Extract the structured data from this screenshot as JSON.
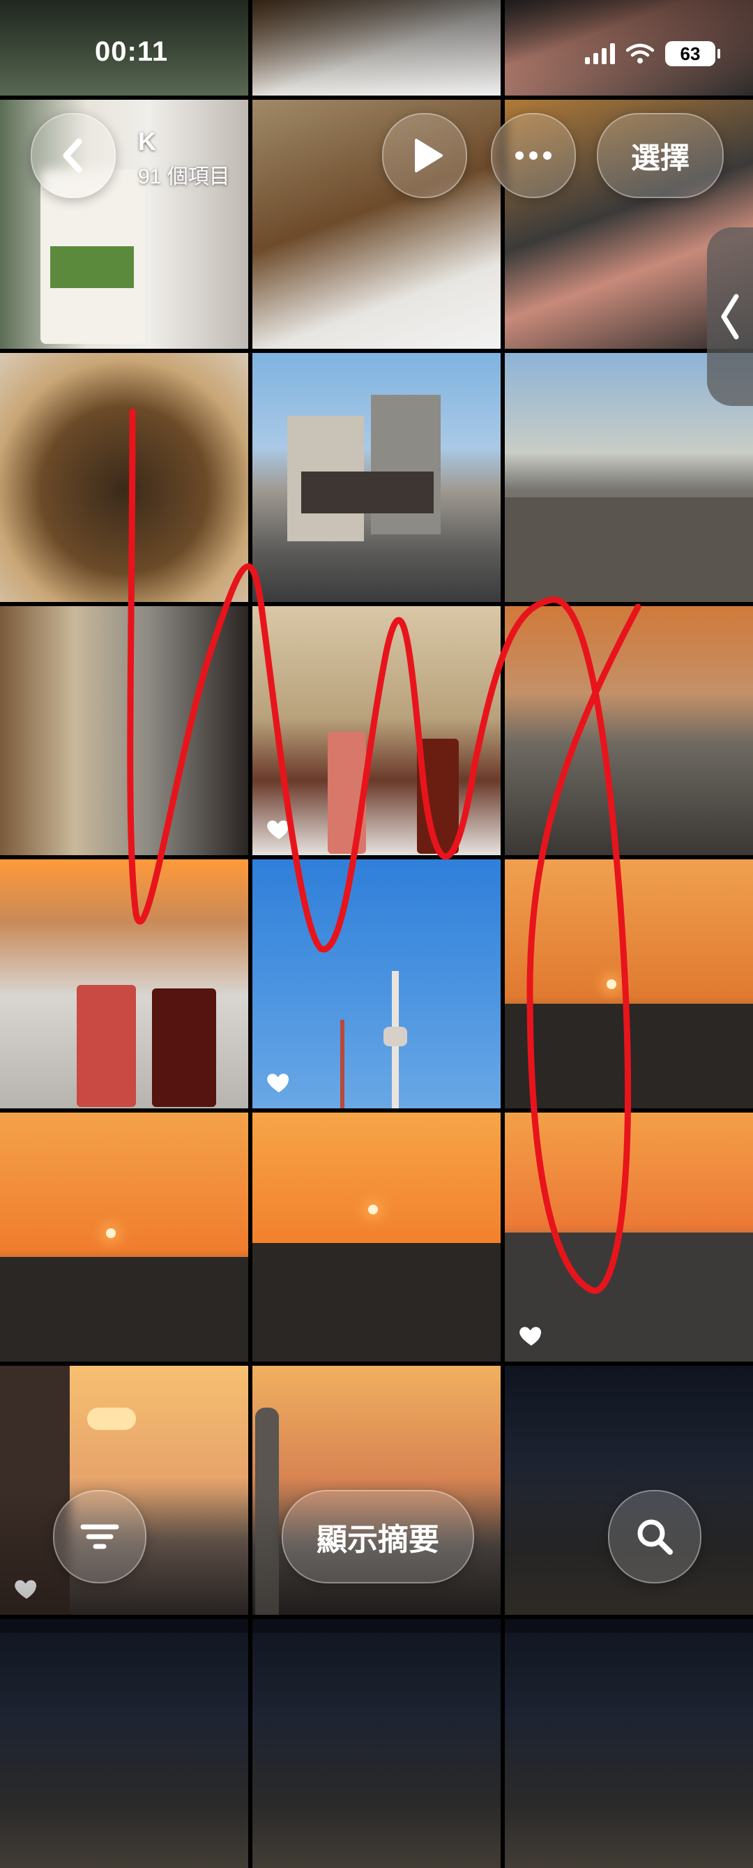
{
  "status_bar": {
    "time": "00:11",
    "battery": "63"
  },
  "header": {
    "album_title": "K",
    "item_count": "91 個項目",
    "select_label": "選擇"
  },
  "bottom_bar": {
    "summary_label": "顯示摘要"
  },
  "colors": {
    "scribble": "#e8141c",
    "glass": "rgba(255,255,255,0.18)"
  },
  "icons": [
    "back-icon",
    "play-icon",
    "more-icon",
    "chevron-left-icon",
    "filter-icon",
    "search-icon",
    "heart-icon",
    "wifi-icon",
    "signal-icon"
  ]
}
